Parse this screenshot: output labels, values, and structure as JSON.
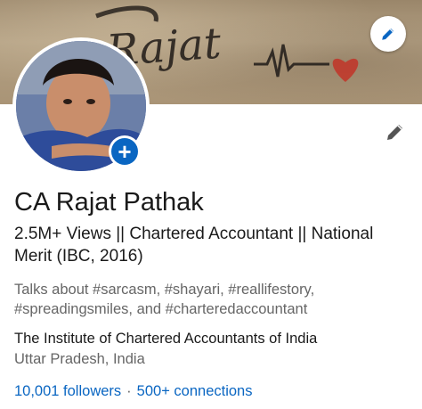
{
  "banner": {
    "tattoo_text": "Rajat",
    "edit_icon": "pencil-icon",
    "heart_color": "#c0392b"
  },
  "avatar": {
    "add_icon": "plus-icon",
    "add_symbol": "+"
  },
  "profile_edit_icon": "pencil-icon",
  "profile": {
    "name": "CA Rajat Pathak",
    "headline": "2.5M+ Views || Chartered Accountant || National Merit (IBC, 2016)",
    "talks_about": "Talks about #sarcasm, #shayari, #reallifestory, #spreadingsmiles, and #charteredaccountant",
    "company": "The Institute of Chartered Accountants of India",
    "location": "Uttar Pradesh, India",
    "followers": "10,001 followers",
    "separator": "·",
    "connections": "500+ connections"
  },
  "colors": {
    "accent": "#0a66c2",
    "muted_text": "#666666",
    "primary_text": "#1a1a1a"
  }
}
